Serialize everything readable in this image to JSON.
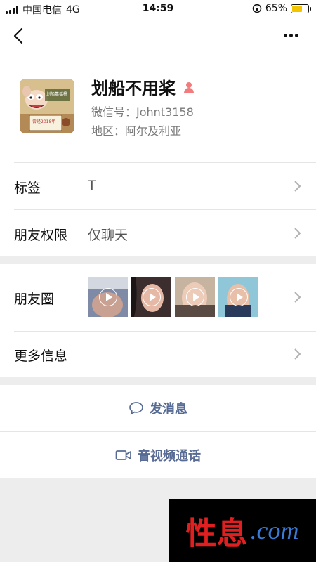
{
  "status": {
    "carrier": "中国电信",
    "network": "4G",
    "time": "14:59",
    "battery_text": "65%",
    "battery_level": 0.65
  },
  "profile": {
    "name": "划船不用桨",
    "wechat_id": "微信号：Johnt3158",
    "region": "地区：阿尔及利亚",
    "avatar_caption_top": "划船靠摇橹",
    "avatar_caption_bottom": "曾经2018年"
  },
  "rows": {
    "tag_label": "标签",
    "tag_value": "T",
    "perm_label": "朋友权限",
    "perm_value": "仅聊天",
    "moments_label": "朋友圈",
    "more_label": "更多信息"
  },
  "actions": {
    "message": "发消息",
    "call": "音视频通话"
  },
  "watermark": {
    "cn": "性息",
    "en": ".com"
  },
  "colors": {
    "link": "#576b95",
    "battery": "#f2c500",
    "gender_icon": "#f37b7b"
  }
}
